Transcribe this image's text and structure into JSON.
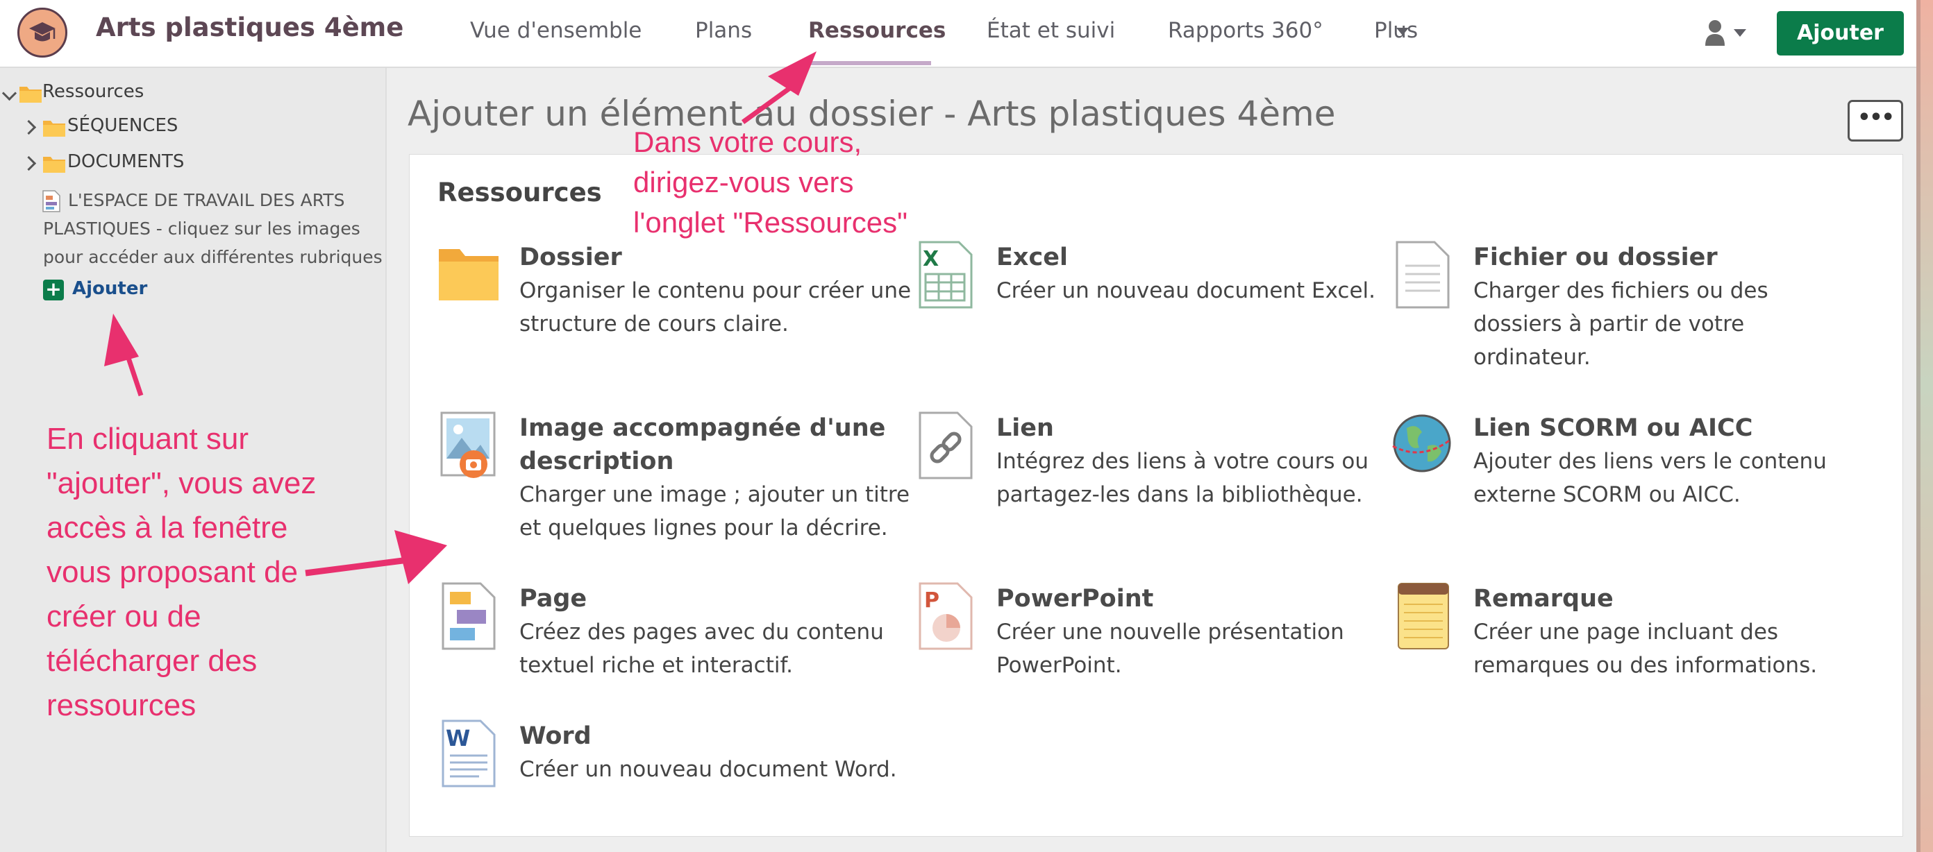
{
  "header": {
    "course_title": "Arts plastiques 4ème",
    "tabs": [
      {
        "label": "Vue d'ensemble",
        "active": false
      },
      {
        "label": "Plans",
        "active": false
      },
      {
        "label": "Ressources",
        "active": true
      },
      {
        "label": "État et suivi",
        "active": false
      },
      {
        "label": "Rapports 360°",
        "active": false
      },
      {
        "label": "Plus",
        "active": false
      }
    ],
    "add_button": "Ajouter",
    "accent_color": "#0b7c4a",
    "icons": [
      "graduation-cap-icon",
      "user-icon",
      "chevron-down-icon"
    ]
  },
  "sidebar": {
    "root_label": "Ressources",
    "items": [
      {
        "label": "SÉQUENCES",
        "type": "folder"
      },
      {
        "label": "DOCUMENTS",
        "type": "folder"
      },
      {
        "label": "L'ESPACE DE TRAVAIL DES ARTS PLASTIQUES - cliquez sur les images pour accéder aux différentes rubriques",
        "type": "page"
      }
    ],
    "add_label": "Ajouter"
  },
  "main": {
    "heading": "Ajouter un élément au dossier - Arts plastiques 4ème",
    "more_button": "•••",
    "panel_title": "Ressources",
    "resources": [
      {
        "title": "Dossier",
        "description": "Organiser le contenu pour créer une structure de cours claire.",
        "icon": "folder-icon"
      },
      {
        "title": "Excel",
        "description": "Créer un nouveau document Excel.",
        "icon": "excel-icon"
      },
      {
        "title": "Fichier ou dossier",
        "description": "Charger des fichiers ou des dossiers à partir de votre ordinateur.",
        "icon": "file-icon"
      },
      {
        "title": "Image accompagnée d'une description",
        "description": "Charger une image ; ajouter un titre et quelques lignes pour la décrire.",
        "icon": "image-icon"
      },
      {
        "title": "Lien",
        "description": "Intégrez des liens à votre cours ou partagez-les dans la bibliothèque.",
        "icon": "link-icon"
      },
      {
        "title": "Lien SCORM ou AICC",
        "description": "Ajouter des liens vers le contenu externe SCORM ou AICC.",
        "icon": "globe-icon"
      },
      {
        "title": "Page",
        "description": "Créez des pages avec du contenu textuel riche et interactif.",
        "icon": "page-icon"
      },
      {
        "title": "PowerPoint",
        "description": "Créer une nouvelle présentation PowerPoint.",
        "icon": "powerpoint-icon"
      },
      {
        "title": "Remarque",
        "description": "Créer une page incluant des remarques ou des informations.",
        "icon": "notepad-icon"
      },
      {
        "title": "Word",
        "description": "Créer un nouveau document Word.",
        "icon": "word-icon"
      }
    ]
  },
  "annotations": {
    "top_note": "Dans votre cours,\ndirigez-vous vers\nl'onglet \"Ressources\"",
    "left_note": "En cliquant sur\n\"ajouter\", vous avez\naccès à la fenêtre\nvous proposant de\ncréer ou de\ntélécharger des\nressources",
    "color": "#e8306e"
  }
}
